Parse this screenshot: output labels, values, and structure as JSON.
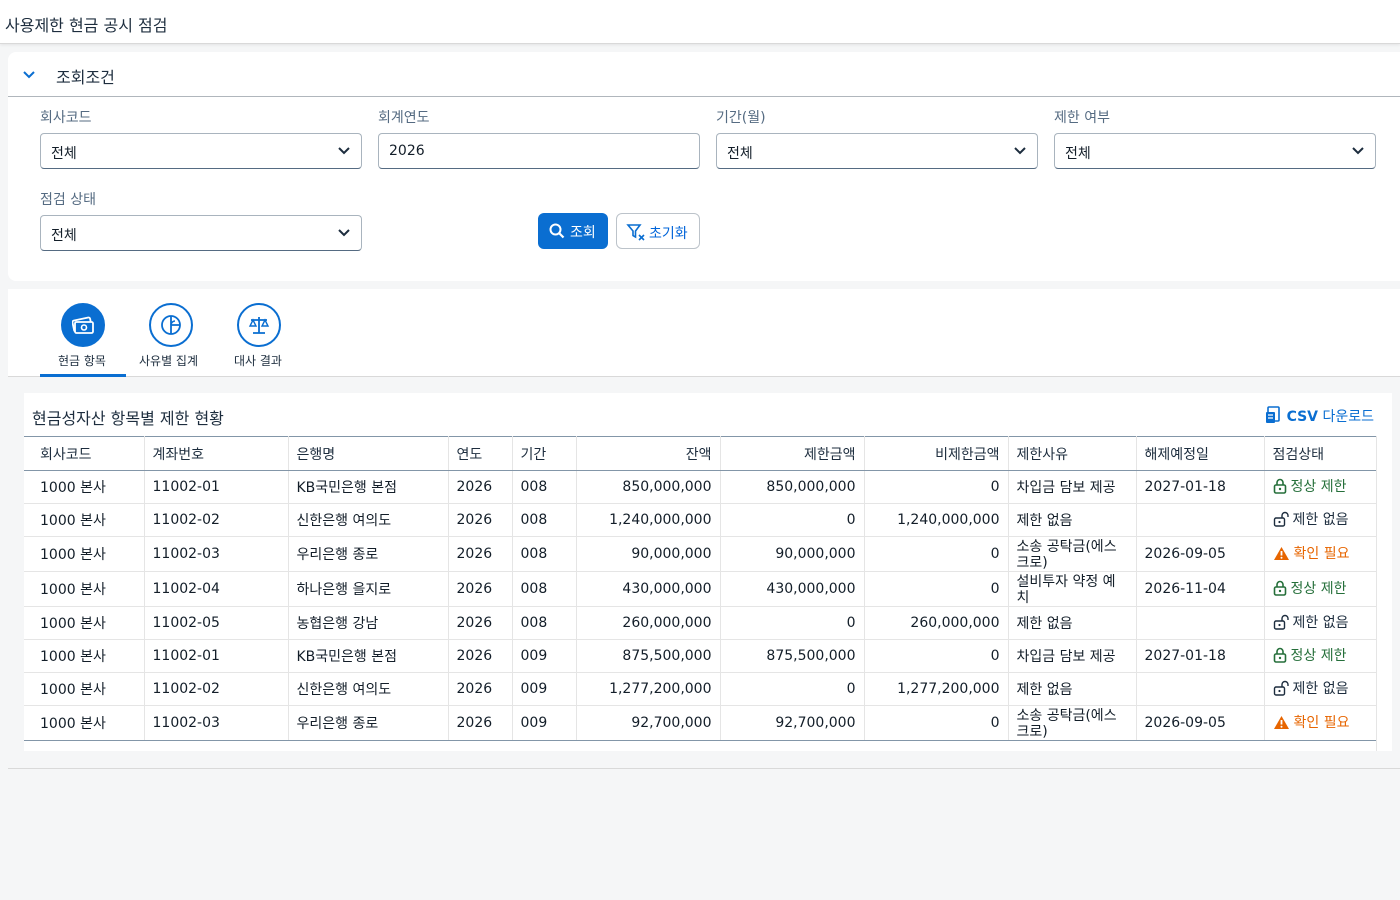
{
  "app": {
    "title": "사용제한 현금 공시 점검"
  },
  "filters": {
    "panel_title": "조회조건",
    "company_code": {
      "label": "회사코드",
      "value": "전체"
    },
    "fiscal_year": {
      "label": "회계연도",
      "value": "2026"
    },
    "period": {
      "label": "기간(월)",
      "value": "전체"
    },
    "restricted": {
      "label": "제한 여부",
      "value": "전체"
    },
    "check_status": {
      "label": "점검 상태",
      "value": "전체"
    },
    "search_label": "조회",
    "reset_label": "초기화"
  },
  "tabs": [
    {
      "label": "현금 항목",
      "icon": "money-icon",
      "active": true
    },
    {
      "label": "사유별 집계",
      "icon": "pie-chart-icon",
      "active": false
    },
    {
      "label": "대사 결과",
      "icon": "balance-scale-icon",
      "active": false
    }
  ],
  "table": {
    "title": "현금성자산 항목별 제한 현황",
    "csv_bold": "CSV",
    "csv_rest": " 다운로드",
    "columns": [
      "회사코드",
      "계좌번호",
      "은행명",
      "연도",
      "기간",
      "잔액",
      "제한금액",
      "비제한금액",
      "제한사유",
      "해제예정일",
      "점검상태"
    ],
    "rows": [
      {
        "company": "1000 본사",
        "account": "11002-01",
        "bank": "KB국민은행 본점",
        "year": "2026",
        "period": "008",
        "balance": "850,000,000",
        "restricted": "850,000,000",
        "unrestricted": "0",
        "reason": "차입금 담보 제공",
        "release": "2027-01-18",
        "status": "정상 제한",
        "status_type": "ok"
      },
      {
        "company": "1000 본사",
        "account": "11002-02",
        "bank": "신한은행 여의도",
        "year": "2026",
        "period": "008",
        "balance": "1,240,000,000",
        "restricted": "0",
        "unrestricted": "1,240,000,000",
        "reason": "제한 없음",
        "release": "",
        "status": "제한 없음",
        "status_type": "none"
      },
      {
        "company": "1000 본사",
        "account": "11002-03",
        "bank": "우리은행 종로",
        "year": "2026",
        "period": "008",
        "balance": "90,000,000",
        "restricted": "90,000,000",
        "unrestricted": "0",
        "reason": "소송 공탁금(에스크로)",
        "release": "2026-09-05",
        "status": "확인 필요",
        "status_type": "warn"
      },
      {
        "company": "1000 본사",
        "account": "11002-04",
        "bank": "하나은행 을지로",
        "year": "2026",
        "period": "008",
        "balance": "430,000,000",
        "restricted": "430,000,000",
        "unrestricted": "0",
        "reason": "설비투자 약정 예치",
        "release": "2026-11-04",
        "status": "정상 제한",
        "status_type": "ok"
      },
      {
        "company": "1000 본사",
        "account": "11002-05",
        "bank": "농협은행 강남",
        "year": "2026",
        "period": "008",
        "balance": "260,000,000",
        "restricted": "0",
        "unrestricted": "260,000,000",
        "reason": "제한 없음",
        "release": "",
        "status": "제한 없음",
        "status_type": "none"
      },
      {
        "company": "1000 본사",
        "account": "11002-01",
        "bank": "KB국민은행 본점",
        "year": "2026",
        "period": "009",
        "balance": "875,500,000",
        "restricted": "875,500,000",
        "unrestricted": "0",
        "reason": "차입금 담보 제공",
        "release": "2027-01-18",
        "status": "정상 제한",
        "status_type": "ok"
      },
      {
        "company": "1000 본사",
        "account": "11002-02",
        "bank": "신한은행 여의도",
        "year": "2026",
        "period": "009",
        "balance": "1,277,200,000",
        "restricted": "0",
        "unrestricted": "1,277,200,000",
        "reason": "제한 없음",
        "release": "",
        "status": "제한 없음",
        "status_type": "none"
      },
      {
        "company": "1000 본사",
        "account": "11002-03",
        "bank": "우리은행 종로",
        "year": "2026",
        "period": "009",
        "balance": "92,700,000",
        "restricted": "92,700,000",
        "unrestricted": "0",
        "reason": "소송 공탁금(에스크로)",
        "release": "2026-09-05",
        "status": "확인 필요",
        "status_type": "warn"
      }
    ]
  },
  "colors": {
    "accent": "#0a6ed1",
    "ok": "#256f3a",
    "warn": "#e76500"
  }
}
